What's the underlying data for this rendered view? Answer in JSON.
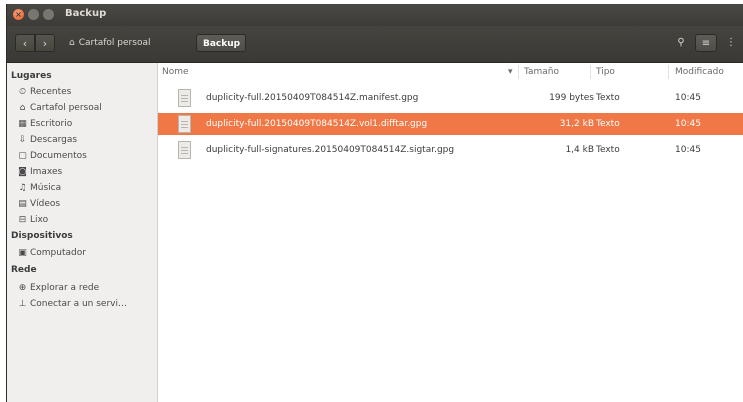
{
  "window": {
    "title": "Backup"
  },
  "toolbar": {
    "back_icon": "‹",
    "forward_icon": "›",
    "breadcrumb": {
      "home_label": "Cartafol persoal",
      "current_label": "Backup"
    },
    "search_icon": "🔍",
    "list_view_icon": "≡",
    "more_icon": "⋮"
  },
  "sidebar": {
    "places_heading": "Lugares",
    "places": [
      {
        "icon": "⏲",
        "label": "Recentes"
      },
      {
        "icon": "⌂",
        "label": "Cartafol persoal"
      },
      {
        "icon": "▦",
        "label": "Escritorio"
      },
      {
        "icon": "⇩",
        "label": "Descargas"
      },
      {
        "icon": "▢",
        "label": "Documentos"
      },
      {
        "icon": "◙",
        "label": "Imaxes"
      },
      {
        "icon": "♫",
        "label": "Música"
      },
      {
        "icon": "▤",
        "label": "Vídeos"
      },
      {
        "icon": "⊟",
        "label": "Lixo"
      }
    ],
    "devices_heading": "Dispositivos",
    "devices": [
      {
        "icon": "▣",
        "label": "Computador"
      }
    ],
    "network_heading": "Rede",
    "network": [
      {
        "icon": "⊕",
        "label": "Explorar a rede"
      },
      {
        "icon": "⊥",
        "label": "Conectar a un servi…"
      }
    ]
  },
  "file_list": {
    "columns": {
      "name": "Nome",
      "size": "Tamaño",
      "type": "Tipo",
      "modified": "Modificado"
    },
    "sort_indicator": "▾",
    "rows": [
      {
        "name": "duplicity-full.20150409T084514Z.manifest.gpg",
        "size": "199 bytes",
        "type": "Texto",
        "modified": "10:45",
        "selected": false
      },
      {
        "name": "duplicity-full.20150409T084514Z.vol1.difftar.gpg",
        "size": "31,2 kB",
        "type": "Texto",
        "modified": "10:45",
        "selected": true
      },
      {
        "name": "duplicity-full-signatures.20150409T084514Z.sigtar.gpg",
        "size": "1,4 kB",
        "type": "Texto",
        "modified": "10:45",
        "selected": false
      }
    ]
  },
  "colors": {
    "accent": "#f07746",
    "titlebar": "#3c3b37",
    "sidebar_bg": "#f0efee"
  }
}
